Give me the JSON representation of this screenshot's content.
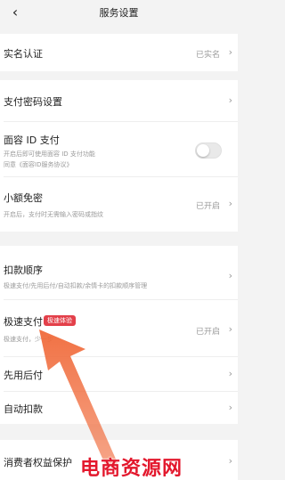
{
  "header": {
    "title": "服务设置",
    "back_icon": "back-arrow-icon"
  },
  "rows": {
    "real_name": {
      "label": "实名认证",
      "value": "已实名"
    },
    "pay_password": {
      "label": "支付密码设置"
    },
    "face_pay": {
      "label": "面容 ID 支付",
      "sub1": "开启后即可使用面容 ID 支付功能",
      "sub2": "同意《面容ID服务协议》",
      "toggle_on": false
    },
    "small_free": {
      "label": "小额免密",
      "sub": "开启后，支付时无需输入密码或指纹",
      "value": "已开启"
    },
    "deduct_order": {
      "label": "扣款顺序",
      "sub": "极速支付/先用后付/自动扣款/余情卡的扣款顺序管理"
    },
    "fast_pay": {
      "label": "极速支付",
      "badge": "极速体验",
      "sub": "极速支付，少一步",
      "value": "已开启"
    },
    "use_first": {
      "label": "先用后付"
    },
    "auto_deduct": {
      "label": "自动扣款"
    },
    "consumer_protect": {
      "label": "消费者权益保护"
    }
  },
  "watermark": "电商资源网",
  "colors": {
    "accent_red": "#e3404a",
    "arrow": "#f06a3a",
    "watermark": "#e3182d"
  }
}
